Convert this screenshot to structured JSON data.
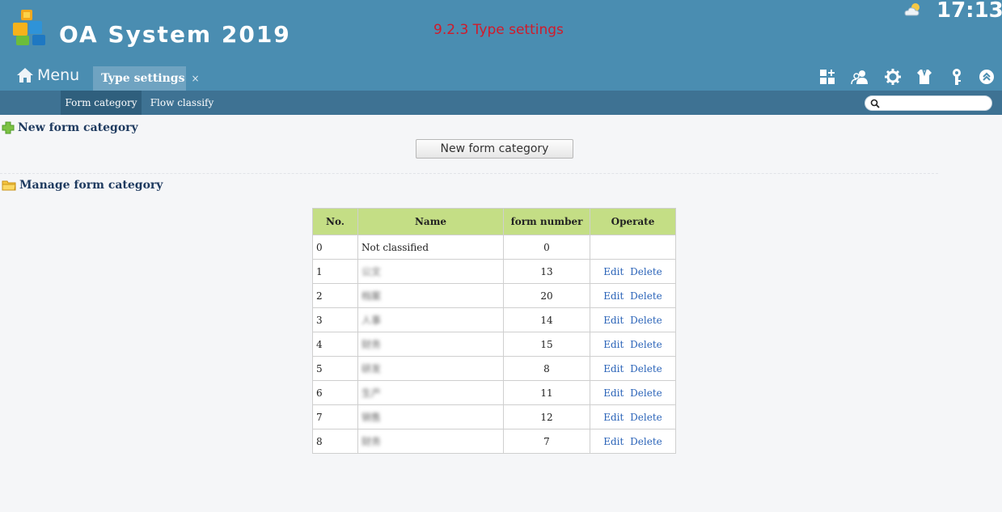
{
  "header": {
    "app_title": "OA System 2019",
    "annotation": "9.2.3 Type settings",
    "clock": "17:13",
    "menu_label": "Menu",
    "active_tab": "Type settings",
    "tab_close": "×",
    "tool_icons": [
      "apps-add-icon",
      "online-users-icon",
      "gear-icon",
      "skin-shirt-icon",
      "key-icon",
      "collapse-up-icon"
    ]
  },
  "subnav": {
    "items": [
      {
        "label": "Form category",
        "active": true
      },
      {
        "label": "Flow classify",
        "active": false
      }
    ],
    "search_value": ""
  },
  "new_section": {
    "heading": "New form category",
    "button_label": "New form category"
  },
  "manage_section": {
    "heading": "Manage form category"
  },
  "table": {
    "columns": [
      "No.",
      "Name",
      "form number",
      "Operate"
    ],
    "edit_label": "Edit",
    "delete_label": "Delete",
    "rows": [
      {
        "no": "0",
        "name": "Not classified",
        "count": "0",
        "blurred": false,
        "ops": false
      },
      {
        "no": "1",
        "name": "公文",
        "count": "13",
        "blurred": true,
        "ops": true
      },
      {
        "no": "2",
        "name": "档案",
        "count": "20",
        "blurred": true,
        "ops": true
      },
      {
        "no": "3",
        "name": "人事",
        "count": "14",
        "blurred": true,
        "ops": true
      },
      {
        "no": "4",
        "name": "财务",
        "count": "15",
        "blurred": true,
        "ops": true
      },
      {
        "no": "5",
        "name": "研发",
        "count": "8",
        "blurred": true,
        "ops": true
      },
      {
        "no": "6",
        "name": "生产",
        "count": "11",
        "blurred": true,
        "ops": true
      },
      {
        "no": "7",
        "name": "销售",
        "count": "12",
        "blurred": true,
        "ops": true
      },
      {
        "no": "8",
        "name": "财务",
        "count": "7",
        "blurred": true,
        "ops": true
      }
    ]
  },
  "colors": {
    "header_bg": "#4a8db1",
    "subnav_bg": "#3e7293",
    "table_header_bg": "#c4de85",
    "link": "#2a63b8",
    "annotation": "#d11a2a"
  }
}
